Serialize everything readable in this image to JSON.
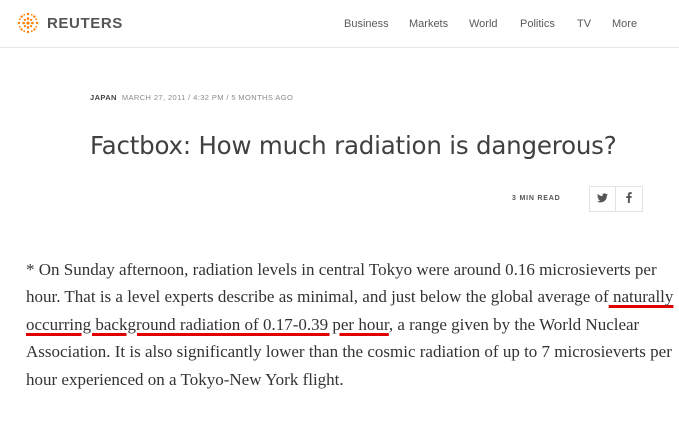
{
  "brand": {
    "name": "REUTERS",
    "logo_icon": "reuters-dot-logo-icon",
    "logo_color": "#ff8000"
  },
  "nav": {
    "items": [
      {
        "label": "Business"
      },
      {
        "label": "Markets"
      },
      {
        "label": "World"
      },
      {
        "label": "Politics"
      },
      {
        "label": "TV"
      },
      {
        "label": "More"
      }
    ]
  },
  "article": {
    "section": "JAPAN",
    "dateline": "MARCH 27, 2011 / 4:32 PM / 5 MONTHS AGO",
    "headline": "Factbox: How much radiation is dangerous?",
    "read_time": "3 MIN READ",
    "share": {
      "twitter_icon": "twitter-icon",
      "facebook_icon": "facebook-icon"
    },
    "paragraph": {
      "before": "* On Sunday afternoon, radiation levels in central Tokyo were around 0.16 microsieverts per hour. That is a level experts describe as minimal, and just below the global average of",
      "highlight": " naturally occurring background radiation of 0.17-0.39 per hour",
      "after": ", a range given by the World Nuclear Association. It is also significantly lower than the cosmic radiation of up to 7 microsieverts per hour experienced on a Tokyo-New York flight."
    },
    "highlight_color": "#e00000"
  }
}
